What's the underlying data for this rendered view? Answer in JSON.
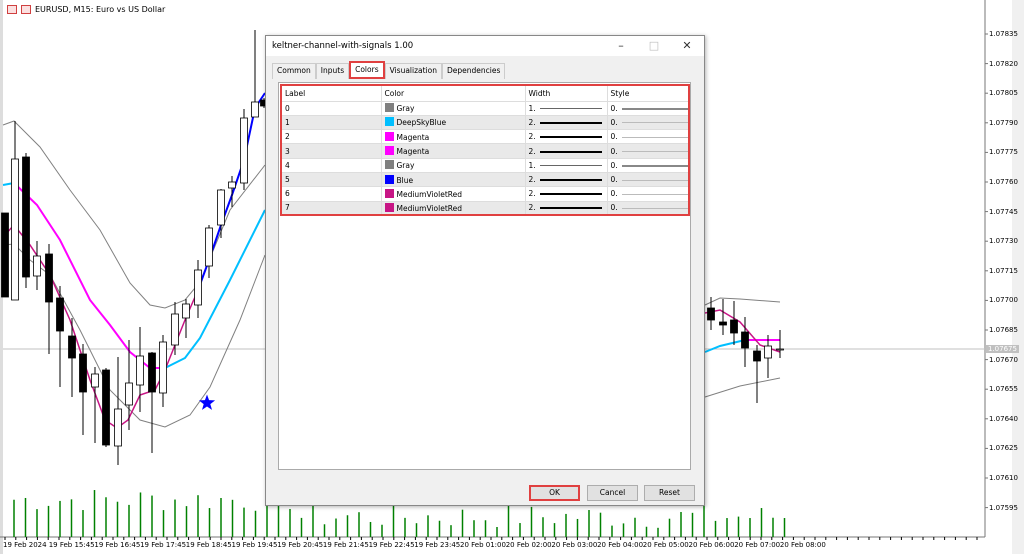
{
  "window": {
    "title": "EURUSD, M15:  Euro vs US Dollar"
  },
  "price_axis": {
    "labels": [
      "1.07835",
      "1.07820",
      "1.07805",
      "1.07790",
      "1.07775",
      "1.07760",
      "1.07745",
      "1.07730",
      "1.07715",
      "1.07700",
      "1.07685",
      "1.07670",
      "1.07655",
      "1.07640",
      "1.07625",
      "1.07610",
      "1.07595"
    ],
    "current": "1.07675"
  },
  "time_axis": {
    "labels": [
      "19 Feb 2024",
      "19 Feb 15:45",
      "19 Feb 16:45",
      "19 Feb 17:45",
      "19 Feb 18:45",
      "19 Feb 19:45",
      "19 Feb 20:45",
      "19 Feb 21:45",
      "19 Feb 22:45",
      "19 Feb 23:45",
      "20 Feb 01:00",
      "20 Feb 02:00",
      "20 Feb 03:00",
      "20 Feb 04:00",
      "20 Feb 05:00",
      "20 Feb 06:00",
      "20 Feb 07:00",
      "20 Feb 08:00"
    ]
  },
  "colors": {
    "gray": "#808080",
    "deepskyblue": "#00bfff",
    "magenta": "#ff00ff",
    "blue": "#0000ff",
    "mediumvioletred": "#c71585",
    "volume": "#008000"
  },
  "dialog": {
    "title": "keltner-channel-with-signals 1.00",
    "tabs": [
      "Common",
      "Inputs",
      "Colors",
      "Visualization",
      "Dependencies"
    ],
    "active_tab": "Colors",
    "columns": [
      "Label",
      "Color",
      "Width",
      "Style"
    ],
    "rows": [
      {
        "label": "0",
        "color": "Gray",
        "hex": "#808080",
        "width": "1.",
        "style": "0."
      },
      {
        "label": "1",
        "color": "DeepSkyBlue",
        "hex": "#00bfff",
        "width": "2.",
        "style": "0."
      },
      {
        "label": "2",
        "color": "Magenta",
        "hex": "#ff00ff",
        "width": "2.",
        "style": "0."
      },
      {
        "label": "3",
        "color": "Magenta",
        "hex": "#ff00ff",
        "width": "2.",
        "style": "0."
      },
      {
        "label": "4",
        "color": "Gray",
        "hex": "#808080",
        "width": "1.",
        "style": "0."
      },
      {
        "label": "5",
        "color": "Blue",
        "hex": "#0000ff",
        "width": "2.",
        "style": "0."
      },
      {
        "label": "6",
        "color": "MediumVioletRed",
        "hex": "#c71585",
        "width": "2.",
        "style": "0."
      },
      {
        "label": "7",
        "color": "MediumVioletRed",
        "hex": "#c71585",
        "width": "2.",
        "style": "0."
      }
    ],
    "buttons": {
      "ok": "OK",
      "cancel": "Cancel",
      "reset": "Reset"
    }
  }
}
